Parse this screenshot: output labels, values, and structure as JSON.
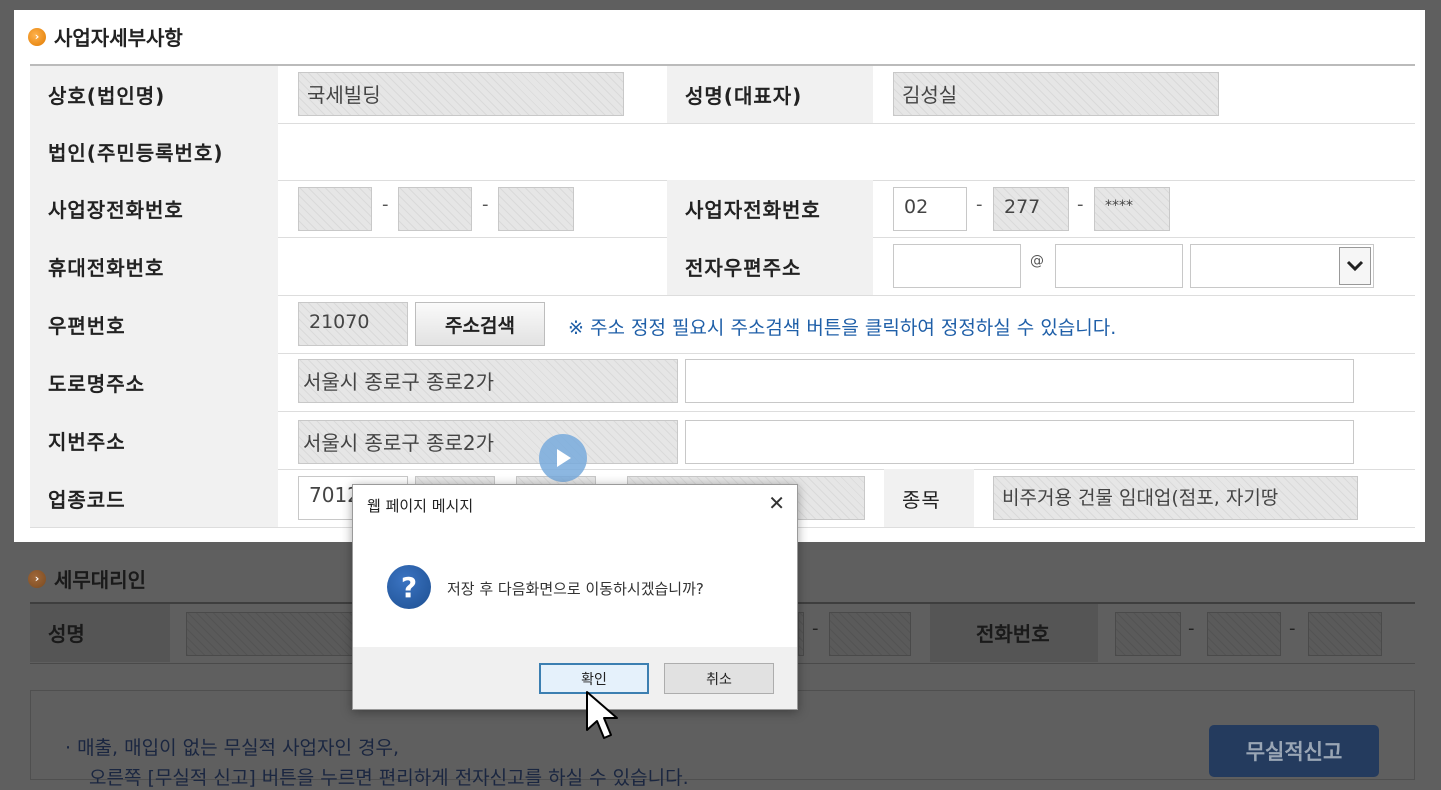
{
  "business_details": {
    "section_title": "사업자세부사항",
    "trade_name_label": "상호(법인명)",
    "trade_name_value": "국세빌딩",
    "rep_name_label": "성명(대표자)",
    "rep_name_value": "김성실",
    "corp_reg_label": "법인(주민등록번호)",
    "biz_phone_label": "사업장전화번호",
    "owner_phone_label": "사업자전화번호",
    "owner_phone": [
      "02",
      "277",
      "****"
    ],
    "mobile_label": "휴대전화번호",
    "email_label": "전자우편주소",
    "email_at": "@",
    "postal_label": "우편번호",
    "postal_value": "21070",
    "address_search_button": "주소검색",
    "address_note": "※ 주소 정정 필요시 주소검색 버튼을 클릭하여 정정하실 수 있습니다.",
    "road_address_label": "도로명주소",
    "road_address_value": "서울시 종로구 종로2가",
    "lot_address_label": "지번주소",
    "lot_address_value": "서울시 종로구 종로2가",
    "industry_code_label": "업종코드",
    "industry_code_value": "7012",
    "item_label": "종목",
    "item_value": "비주거용 건물 임대업(점포, 자기땅"
  },
  "tax_agent": {
    "section_title": "세무대리인",
    "name_label": "성명",
    "phone_label": "전화번호"
  },
  "notice": {
    "line1": "· 매출, 매입이 없는 무실적 사업자인 경우,",
    "line2": "오른쪽 [무실적 신고] 버튼을 누르면 편리하게 전자신고를 하실 수 있습니다.",
    "no_record_button": "무실적신고"
  },
  "dialog": {
    "title": "웹 페이지 메시지",
    "message": "저장 후 다음화면으로 이동하시겠습니까?",
    "ok_label": "확인",
    "cancel_label": "취소",
    "question_glyph": "?",
    "close_glyph": "✕"
  },
  "colors": {
    "accent_orange": "#e07a00",
    "note_blue": "#1f5fa8",
    "dialog_icon_blue": "#1d4f91"
  }
}
